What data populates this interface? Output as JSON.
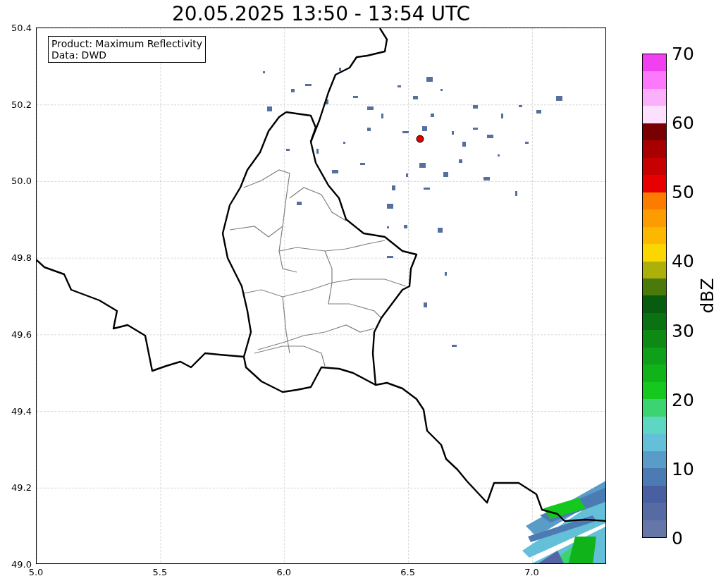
{
  "title": "20.05.2025 13:50 - 13:54 UTC",
  "info_box": {
    "lines": [
      "Product: Maximum Reflectivity",
      "Data: DWD"
    ]
  },
  "map": {
    "x_ticks": [
      "5.0",
      "5.5",
      "6.0",
      "6.5",
      "7.0"
    ],
    "y_ticks": [
      "50.4",
      "50.2",
      "50.0",
      "49.8",
      "49.6",
      "49.4",
      "49.2",
      "49.0"
    ]
  },
  "colorbar": {
    "label": "dBZ",
    "ticks": [
      "70",
      "60",
      "50",
      "40",
      "30",
      "20",
      "10",
      "0"
    ],
    "bands": [
      {
        "color": "#6577a8"
      },
      {
        "color": "#566aa4"
      },
      {
        "color": "#4860a2"
      },
      {
        "color": "#4c7bb4"
      },
      {
        "color": "#5a9cc8"
      },
      {
        "color": "#64c0d8"
      },
      {
        "color": "#5ed6c4"
      },
      {
        "color": "#3cd470"
      },
      {
        "color": "#14c81e"
      },
      {
        "color": "#10b41a"
      },
      {
        "color": "#0ea018"
      },
      {
        "color": "#0c8a14"
      },
      {
        "color": "#0a7212"
      },
      {
        "color": "#085c10"
      },
      {
        "color": "#4a7a0a"
      },
      {
        "color": "#aeb00a"
      },
      {
        "color": "#fcd600"
      },
      {
        "color": "#fcb800"
      },
      {
        "color": "#fc9c00"
      },
      {
        "color": "#fc7c00"
      },
      {
        "color": "#e80000"
      },
      {
        "color": "#c80000"
      },
      {
        "color": "#a80000"
      },
      {
        "color": "#780000"
      },
      {
        "color": "#fce0fc"
      },
      {
        "color": "#fcb0fc"
      },
      {
        "color": "#fc78fc"
      },
      {
        "color": "#f040f0"
      }
    ]
  }
}
